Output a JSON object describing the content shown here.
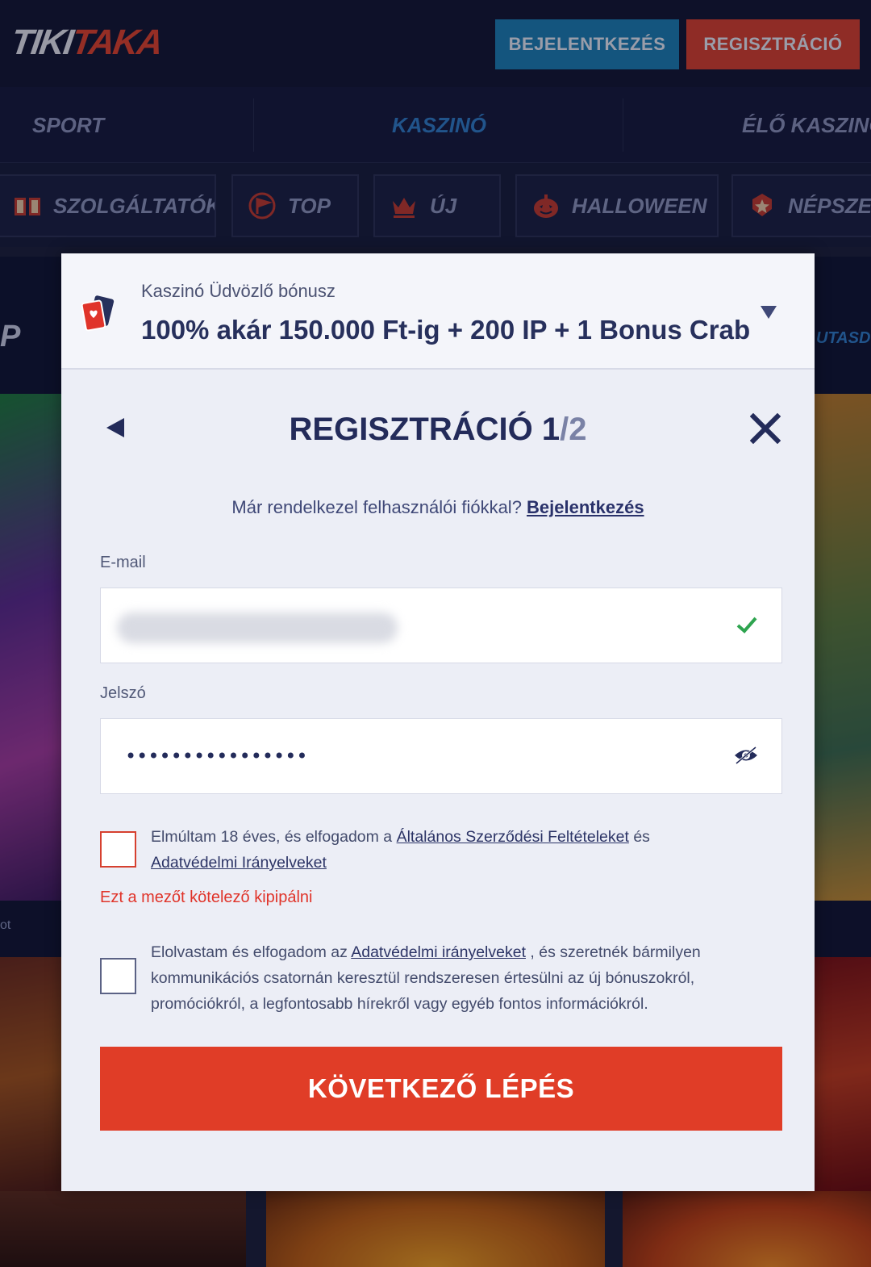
{
  "header": {
    "logo_part1": "TIKI",
    "logo_part2": "TAKA",
    "login_label": "BEJELENTKEZÉS",
    "register_label": "REGISZTRÁCIÓ"
  },
  "nav": {
    "items": [
      {
        "label": "SPORT",
        "active": false
      },
      {
        "label": "KASZINÓ",
        "active": true
      },
      {
        "label": "ÉLŐ KASZINÓ",
        "active": false
      }
    ]
  },
  "categories": [
    {
      "label": "SZOLGÁLTATÓK",
      "icon": "book-icon"
    },
    {
      "label": "TOP",
      "icon": "flag-icon"
    },
    {
      "label": "ÚJ",
      "icon": "crown-icon"
    },
    {
      "label": "HALLOWEEN",
      "icon": "pumpkin-icon"
    },
    {
      "label": "NÉPSZE",
      "icon": "star-badge-icon"
    }
  ],
  "background": {
    "section_fragment": "P",
    "right_fragment": "UTASD",
    "caption_fragment": "ot"
  },
  "modal": {
    "bonus": {
      "subtitle": "Kaszinó Üdvözlő bónusz",
      "title": "100% akár 150.000 Ft-ig + 200 IP + 1 Bonus Crab",
      "icon": "cards-icon"
    },
    "form": {
      "title_main": "REGISZTRÁCIÓ 1",
      "title_step": "/2",
      "have_account_text": "Már rendelkezel felhasználói fiókkal? ",
      "have_account_link": "Bejelentkezés",
      "email_label": "E-mail",
      "email_value": "",
      "password_label": "Jelszó",
      "password_value": "••••••••••••••••",
      "terms_text_1": "Elmúltam 18 éves, és elfogadom a ",
      "terms_link_1": "Általános Szerződési Feltételeket",
      "terms_text_2": " és ",
      "terms_link_2": "Adatvédelmi Irányelveket",
      "terms_error": "Ezt a mezőt kötelező kipipálni",
      "marketing_text_1": "Elolvastam és elfogadom az ",
      "marketing_link": "Adatvédelmi irányelveket",
      "marketing_text_2": " , és szeretnék bármilyen kommunikációs csatornán keresztül rendszeresen értesülni az új bónuszokról, promóciókról, a legfontosabb hírekről vagy egyéb fontos információkról.",
      "next_label": "KÖVETKEZŐ LÉPÉS"
    }
  },
  "colors": {
    "header_bg": "#111631",
    "login_btn": "#1b7fb3",
    "register_btn": "#d8402c",
    "nav_active": "#2f7dc7",
    "modal_bg": "#eceef6",
    "title": "#232b5a",
    "error": "#e0342a",
    "success_check": "#2ea44f",
    "primary_cta": "#e03d27"
  }
}
